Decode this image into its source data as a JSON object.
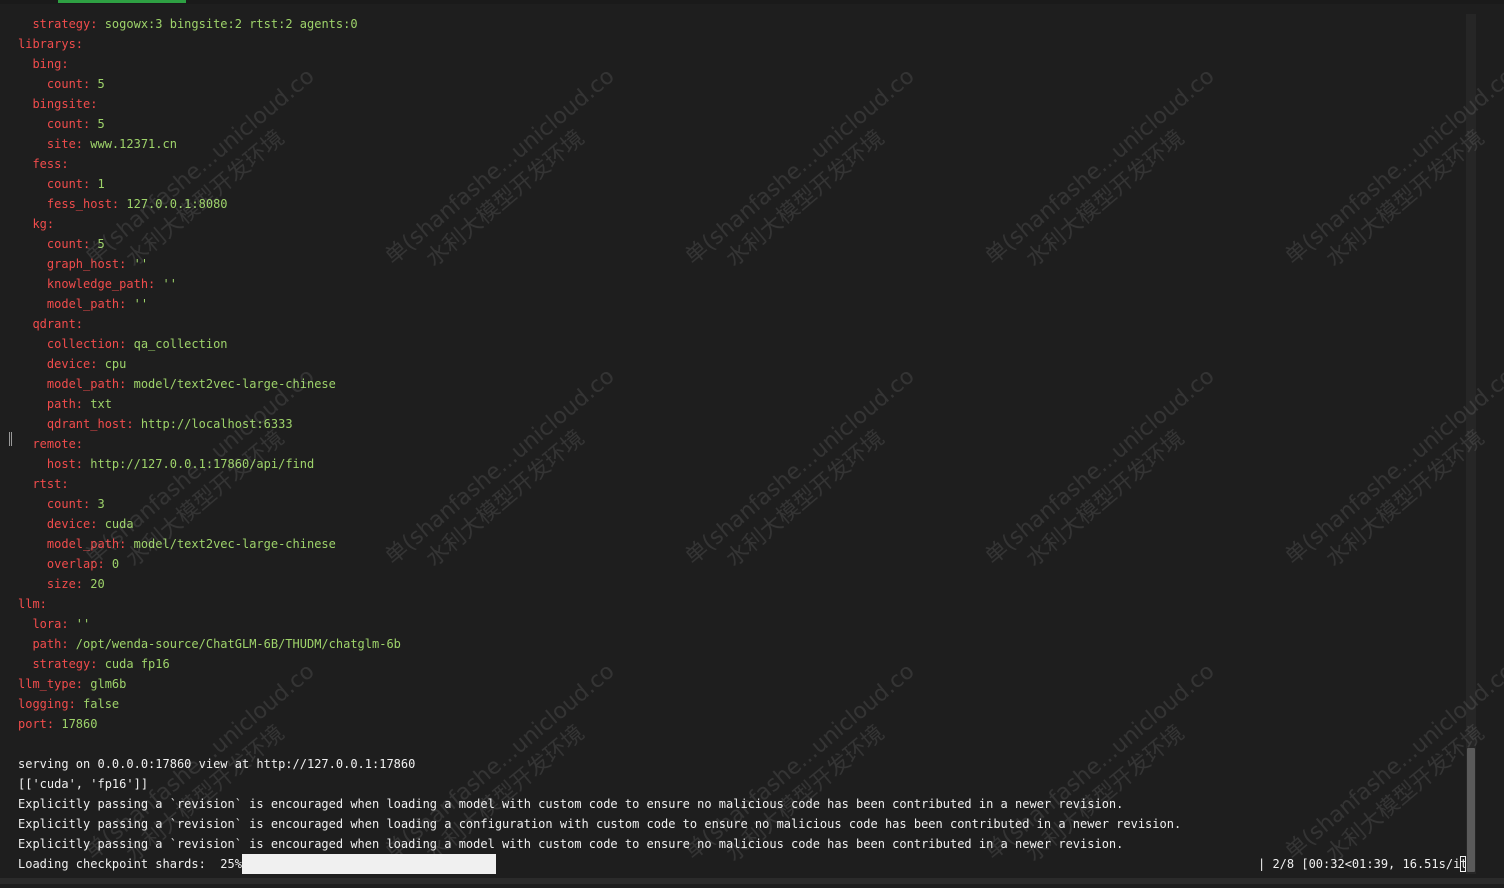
{
  "terminal": {
    "lines": [
      {
        "key": "  strategy: ",
        "value": "sogowx:3 bingsite:2 rtst:2 agents:0"
      },
      {
        "key": "librarys:",
        "value": ""
      },
      {
        "key": "  bing:",
        "value": ""
      },
      {
        "key": "    count: ",
        "value": "5"
      },
      {
        "key": "  bingsite:",
        "value": ""
      },
      {
        "key": "    count: ",
        "value": "5"
      },
      {
        "key": "    site: ",
        "value": "www.12371.cn"
      },
      {
        "key": "  fess:",
        "value": ""
      },
      {
        "key": "    count: ",
        "value": "1"
      },
      {
        "key": "    fess_host: ",
        "value": "127.0.0.1:8080"
      },
      {
        "key": "  kg:",
        "value": ""
      },
      {
        "key": "    count: ",
        "value": "5"
      },
      {
        "key": "    graph_host: ",
        "value": "''"
      },
      {
        "key": "    knowledge_path: ",
        "value": "''"
      },
      {
        "key": "    model_path: ",
        "value": "''"
      },
      {
        "key": "  qdrant:",
        "value": ""
      },
      {
        "key": "    collection: ",
        "value": "qa_collection"
      },
      {
        "key": "    device: ",
        "value": "cpu"
      },
      {
        "key": "    model_path: ",
        "value": "model/text2vec-large-chinese"
      },
      {
        "key": "    path: ",
        "value": "txt"
      },
      {
        "key": "    qdrant_host: ",
        "value": "http://localhost:6333"
      },
      {
        "key": "  remote:",
        "value": ""
      },
      {
        "key": "    host: ",
        "value": "http://127.0.0.1:17860/api/find"
      },
      {
        "key": "  rtst:",
        "value": ""
      },
      {
        "key": "    count: ",
        "value": "3"
      },
      {
        "key": "    device: ",
        "value": "cuda"
      },
      {
        "key": "    model_path: ",
        "value": "model/text2vec-large-chinese"
      },
      {
        "key": "    overlap: ",
        "value": "0"
      },
      {
        "key": "    size: ",
        "value": "20"
      },
      {
        "key": "llm:",
        "value": ""
      },
      {
        "key": "  lora: ",
        "value": "''"
      },
      {
        "key": "  path: ",
        "value": "/opt/wenda-source/ChatGLM-6B/THUDM/chatglm-6b"
      },
      {
        "key": "  strategy: ",
        "value": "cuda fp16"
      },
      {
        "key": "llm_type: ",
        "value": "glm6b"
      },
      {
        "key": "logging: ",
        "value": "false"
      },
      {
        "key": "port: ",
        "value": "17860"
      }
    ],
    "output_lines": [
      "",
      "serving on 0.0.0.0:17860 view at http://127.0.0.1:17860",
      "[['cuda', 'fp16']]",
      "Explicitly passing a `revision` is encouraged when loading a model with custom code to ensure no malicious code has been contributed in a newer revision.",
      "Explicitly passing a `revision` is encouraged when loading a configuration with custom code to ensure no malicious code has been contributed in a newer revision.",
      "Explicitly passing a `revision` is encouraged when loading a model with custom code to ensure no malicious code has been contributed in a newer revision."
    ],
    "progress": {
      "label": "Loading checkpoint shards:  25%|",
      "fraction": 0.25,
      "status": "| 2/8 [00:32<01:39, 16.51s/it]"
    }
  },
  "watermark": {
    "line1": "单(shanfashe...unicloud.co",
    "line2": "水利大模型开发环境"
  },
  "colors": {
    "background": "#1e1e1e",
    "key": "#f14c4c",
    "value": "#9ed36a",
    "output": "#f0f0f0",
    "accent": "#2ea043"
  }
}
